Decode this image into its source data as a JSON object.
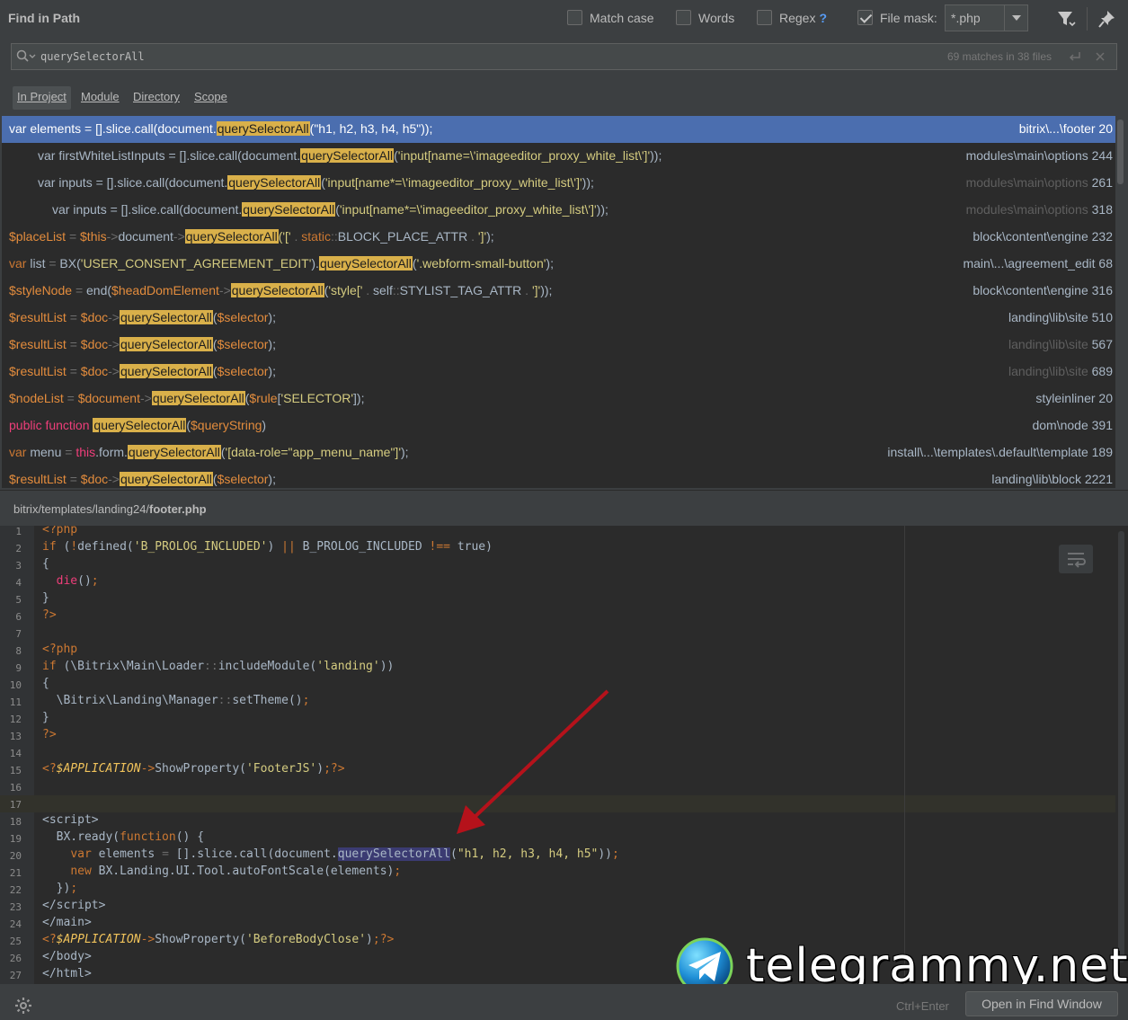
{
  "header": {
    "title": "Find in Path",
    "options": {
      "match_case": "Match case",
      "words": "Words",
      "regex": "Regex",
      "regex_help": "?",
      "file_mask": "File mask:"
    },
    "file_mask_value": "*.php"
  },
  "search": {
    "value": "querySelectorAll",
    "match_count": "69 matches in 38 files"
  },
  "scopes": [
    "In Project",
    "Module",
    "Directory",
    "Scope"
  ],
  "results": [
    {
      "path_dim": "bitrix\\...\\footer",
      "line": "20"
    },
    {
      "path_dim": "modules\\main\\options",
      "line": "244"
    },
    {
      "path_dim": "modules\\main\\options",
      "line": "261"
    },
    {
      "path_dim": "modules\\main\\options",
      "line": "318"
    },
    {
      "path_dim": "block\\content\\engine",
      "line": "232"
    },
    {
      "path_dim": "main\\...\\agreement_edit",
      "line": "68"
    },
    {
      "path_dim": "block\\content\\engine",
      "line": "316"
    },
    {
      "path_dim": "landing\\lib\\site",
      "line": "510"
    },
    {
      "path_dim": "landing\\lib\\site",
      "line": "567"
    },
    {
      "path_dim": "landing\\lib\\site",
      "line": "689"
    },
    {
      "path_dim": "styleinliner",
      "line": "20"
    },
    {
      "path_dim": "dom\\node",
      "line": "391"
    },
    {
      "path_dim": "install\\...\\templates\\.default\\template",
      "line": "189"
    },
    {
      "path_dim": "landing\\lib\\block",
      "line": "2221"
    }
  ],
  "preview": {
    "file_dir": "bitrix/templates/landing24/",
    "file_name": "footer.php",
    "line_numbers": [
      "1",
      "2",
      "3",
      "4",
      "5",
      "6",
      "7",
      "8",
      "9",
      "10",
      "11",
      "12",
      "13",
      "14",
      "15",
      "16",
      "17",
      "18",
      "19",
      "20",
      "21",
      "22",
      "23",
      "24",
      "25",
      "26",
      "27"
    ]
  },
  "watermark": "telegrammy.net",
  "footer": {
    "shortcut": "Ctrl+Enter",
    "open_button": "Open in Find Window"
  }
}
